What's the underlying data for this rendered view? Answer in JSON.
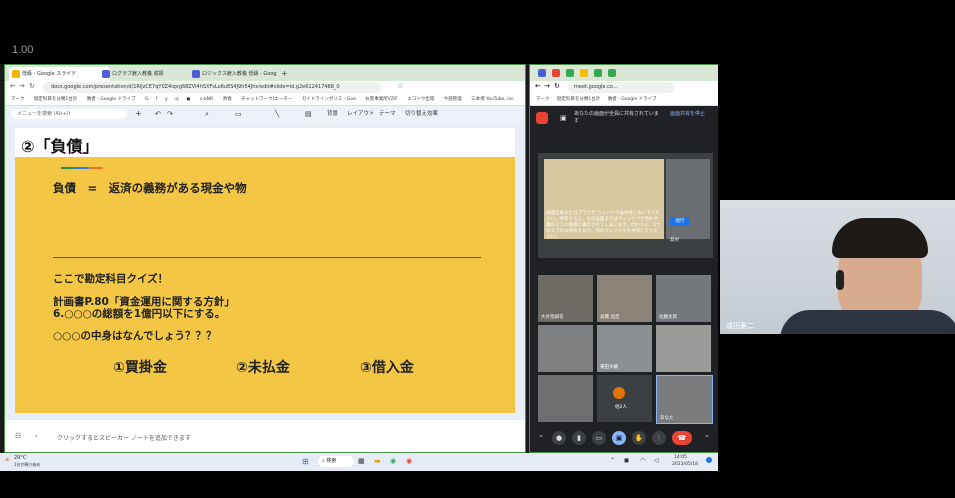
{
  "zoom_label": "1.00",
  "left_window": {
    "tabs": [
      {
        "label": "低級 - Google スライド",
        "color": "#f4b400"
      },
      {
        "label": "ログラブ雇入教養 成振",
        "color": "#4c5fd7"
      },
      {
        "label": "ロジックス雇入教養 低級 - Goog",
        "color": "#4c5fd7"
      }
    ],
    "url": "docs.google.com/presentation/d/1RlJzCE7qY0Z4iqvg68ZVl4hSXFsLo6uES4J9h54Jhx/edit#slide=id.g2e612417468_0",
    "bookmarks": [
      "マーク",
      "勘定科目を分類1台計",
      "勝者 - Google ドライブ",
      "G",
      "f",
      "y",
      "◎",
      "●",
      "c-bNR",
      "青春",
      "チャットワーク[エーター",
      "ガイドラインボリス - Goo",
      "お客事業所VZIF",
      "エコトウ出席",
      "今週管理",
      "三本博 YouTube, inc"
    ],
    "toolbar": {
      "search_placeholder": "メニューを検索 (Alt+/)",
      "items": [
        "背景",
        "レイアウト",
        "テーマ",
        "切り替え効果"
      ]
    },
    "slide": {
      "title": "②「負債」",
      "definition": "負債　=　返済の義務がある現金や物",
      "quiz_heading": "ここで勘定科目クイズ！",
      "plan_line1": "計画書P.80「資金運用に関する方針」",
      "plan_line2": "6.○○○の総額を1億円以下にする。",
      "question": "○○○の中身はなんでしょう？？？",
      "options": [
        "①買掛金",
        "②未払金",
        "③借入金"
      ]
    },
    "notes_placeholder": "クリックするとスピーカー ノートを追加できます"
  },
  "right_window": {
    "url": "meet.google.co...",
    "bookmarks": [
      "マーク",
      "勘定科目を分類1台計",
      "勝者 - Google ドライブ"
    ],
    "share_banner": "あなたの画面が全員に共有されています",
    "share_stop": "画面共有を停止",
    "preview_notice": "画面全体またはブラウザ ウィンドウは共有しないでください。共有すると、その画面またはウィンドウが合わせ鏡のように無限に表示されてしまいます。代わりに、1つのタブのみ共有するか、別のウィンドウを共有してください。",
    "preview_button": "続行",
    "preview_button2": "無視",
    "participants": [
      {
        "name": "大谷皇嗣花"
      },
      {
        "name": "高橋 北音"
      },
      {
        "name": "佐藤太郎"
      },
      {
        "name": ""
      },
      {
        "name": "東田大輔"
      },
      {
        "name": ""
      },
      {
        "name": ""
      },
      {
        "name": "他2人"
      },
      {
        "name": "あなた"
      }
    ]
  },
  "taskbar": {
    "weather": "29°C",
    "weather_sub": "1台が降り始め",
    "search": "検索",
    "time": "14:05",
    "date": "2023/05/18"
  },
  "webcam": {
    "name": "成田憲二"
  },
  "colors": {
    "slide_bg": "#f3c744",
    "accent_green": "#4a8c4a",
    "end_call": "#ea4335"
  }
}
